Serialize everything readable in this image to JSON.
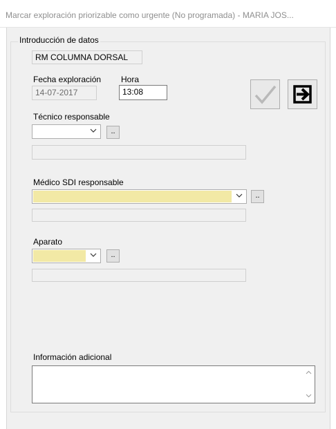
{
  "window": {
    "title": "Marcar exploración priorizable como urgente (No programada) - MARIA JOS..."
  },
  "form": {
    "group_title": "Introducción de datos",
    "exploration_name": "RM COLUMNA DORSAL",
    "fecha_label": "Fecha exploración",
    "fecha_value": "14-07-2017",
    "hora_label": "Hora",
    "hora_value": "13:08",
    "tecnico_label": "Técnico responsable",
    "tecnico_value": "",
    "tecnico_detail": "",
    "medico_label": "Médico SDI responsable",
    "medico_value": "",
    "medico_detail": "",
    "aparato_label": "Aparato",
    "aparato_value": "",
    "aparato_detail": "",
    "info_label": "Información adicional",
    "info_value": "",
    "browse_label": ".."
  },
  "buttons": {
    "accept_icon": "checkmark-icon",
    "exit_icon": "exit-arrow-icon"
  },
  "colors": {
    "required_field": "#f2e9a5",
    "window_bg": "#f0f0f0",
    "accept_icon_disabled": "#b9b9b9"
  }
}
